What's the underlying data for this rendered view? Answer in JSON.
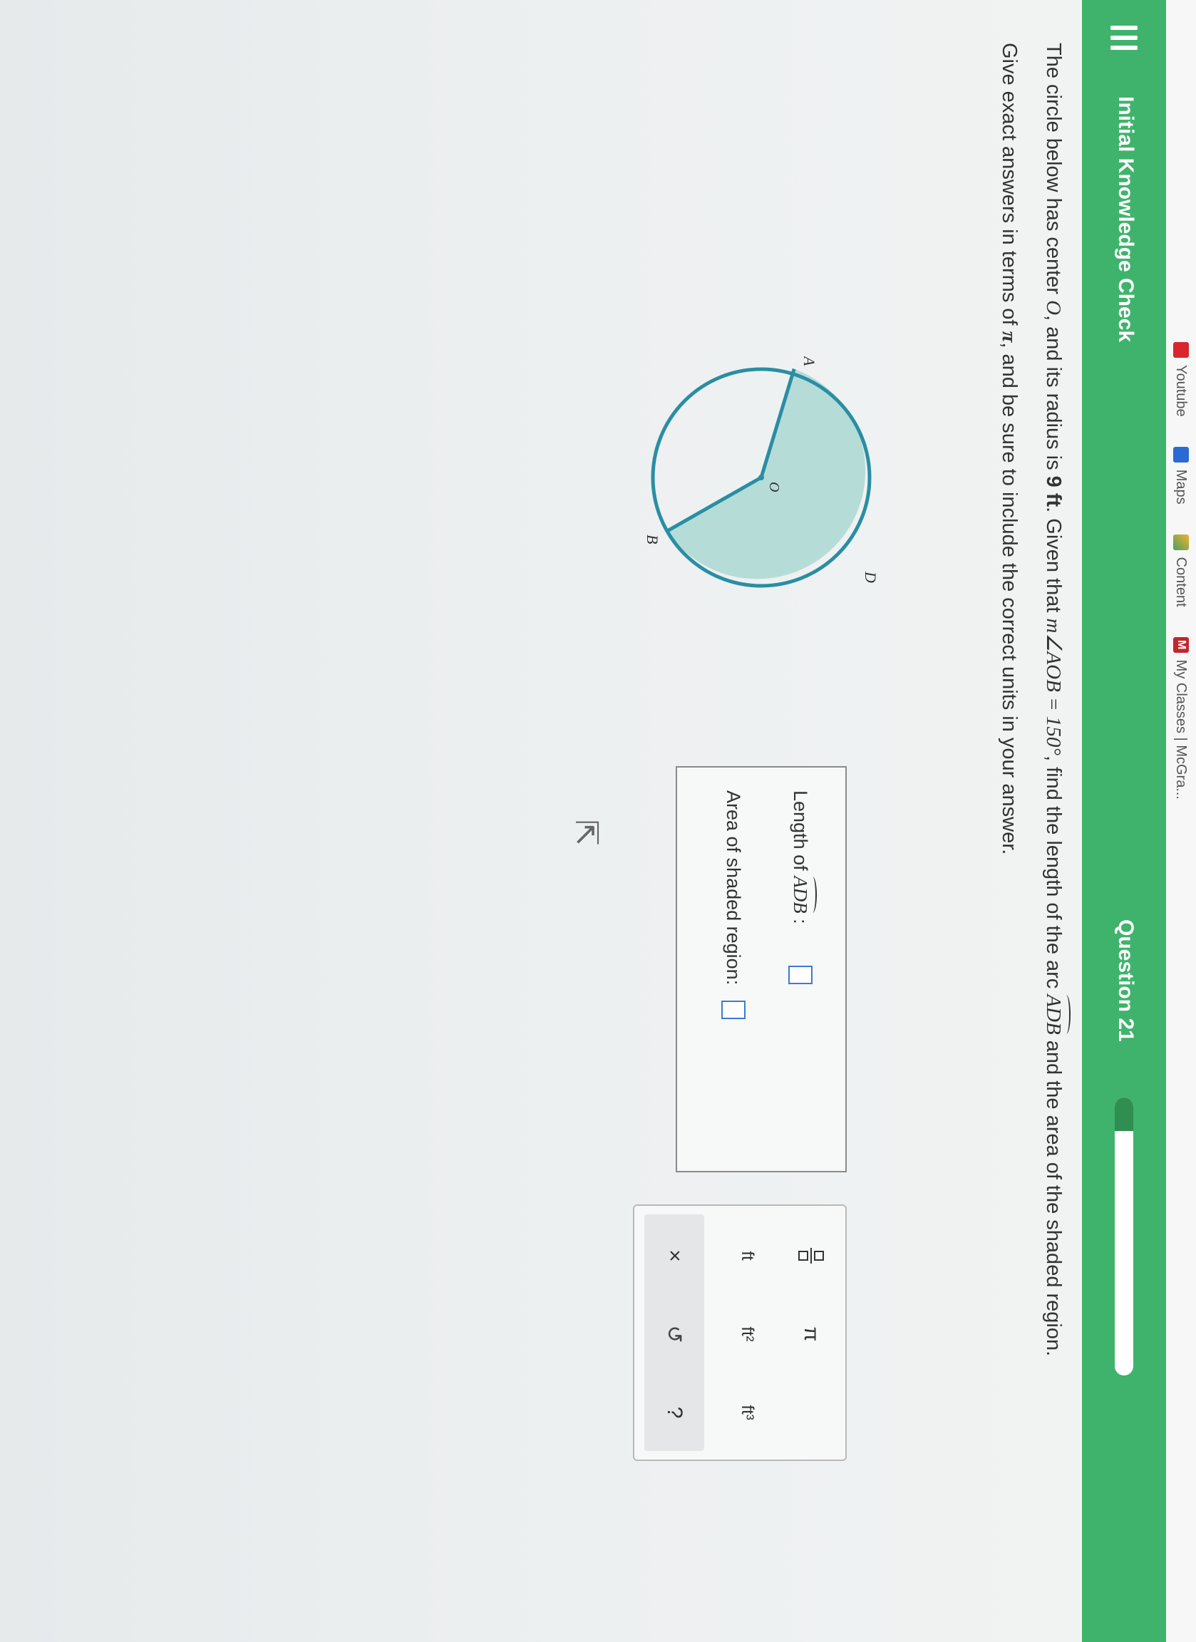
{
  "bookmarks": [
    {
      "label": "Youtube",
      "icon": "youtube-icon"
    },
    {
      "label": "Maps",
      "icon": "maps-icon"
    },
    {
      "label": "Content",
      "icon": "content-icon"
    },
    {
      "label": "My Classes | McGra...",
      "icon": "mcgraw-icon"
    }
  ],
  "header": {
    "title": "Initial Knowledge Check",
    "question": "Question 21",
    "progress_fraction": 0.12,
    "colors": {
      "accent": "#3fb36c",
      "progress_fill": "#2f8e52"
    }
  },
  "prompt": {
    "line1_a": "The circle below has center ",
    "line1_center": "O",
    "line1_b": ", and its radius is ",
    "line1_radius": "9 ft",
    "line1_c": ". Given that ",
    "line1_angle": "m∠AOB = 150°",
    "line1_d": ", find the length of the arc ",
    "line1_arc": "ADB",
    "line1_e": " and the area of the shaded region.",
    "line2_a": "Give exact answers in terms of ",
    "line2_pi": "π",
    "line2_b": ", and be sure to include the correct units in your answer."
  },
  "diagram": {
    "labels": {
      "D": "D",
      "O": "O",
      "A": "A",
      "B": "B"
    },
    "colors": {
      "stroke": "#2a8ea3",
      "fill": "#b6dcd8"
    }
  },
  "answers": {
    "arc_label_pre": "Length of ",
    "arc_label_arc": "ADB",
    "arc_label_post": " :",
    "area_label": "Area of shaded region:"
  },
  "keypad": {
    "pi": "π",
    "ft": "ft",
    "ft2": "ft²",
    "ft3": "ft³",
    "clear": "×",
    "undo": "↺",
    "help": "?"
  }
}
